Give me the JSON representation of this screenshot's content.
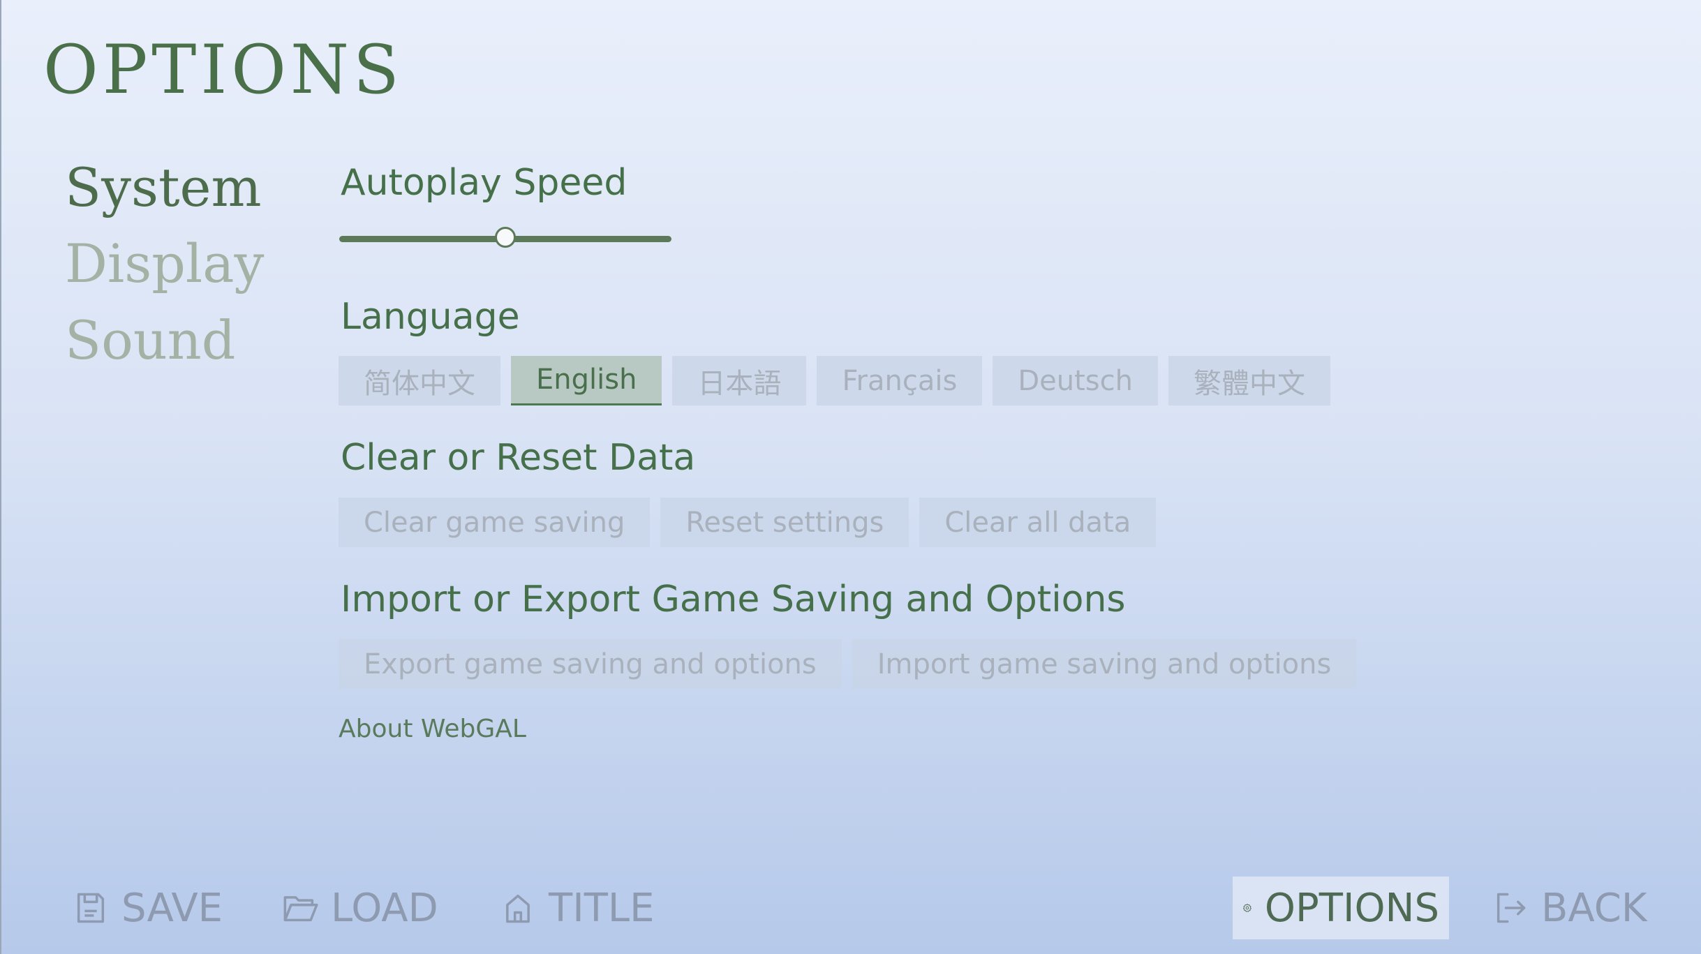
{
  "header": {
    "title": "OPTIONS"
  },
  "sidebar": {
    "tabs": [
      {
        "label": "System",
        "active": true
      },
      {
        "label": "Display",
        "active": false
      },
      {
        "label": "Sound",
        "active": false
      }
    ]
  },
  "system": {
    "autoplay": {
      "title": "Autoplay Speed",
      "value_fraction": 0.5
    },
    "language": {
      "title": "Language",
      "options": [
        "简体中文",
        "English",
        "日本語",
        "Français",
        "Deutsch",
        "繁體中文"
      ],
      "selected": "English"
    },
    "clear": {
      "title": "Clear or Reset Data",
      "buttons": [
        "Clear game saving",
        "Reset settings",
        "Clear all data"
      ]
    },
    "import_export": {
      "title": "Import or Export Game Saving and Options",
      "buttons": [
        "Export game saving and options",
        "Import game saving and options"
      ]
    },
    "about": "About WebGAL"
  },
  "bottom_nav": {
    "save": {
      "label": "SAVE",
      "icon": "save-icon"
    },
    "load": {
      "label": "LOAD",
      "icon": "folder-icon"
    },
    "title": {
      "label": "TITLE",
      "icon": "home-icon"
    },
    "options": {
      "label": "OPTIONS",
      "icon": "gear-icon"
    },
    "back": {
      "label": "BACK",
      "icon": "logout-icon"
    }
  },
  "colors": {
    "accent": "#4a7049",
    "inactive_text": "#a3b2a4",
    "button_bg": "#c8d4e7"
  }
}
